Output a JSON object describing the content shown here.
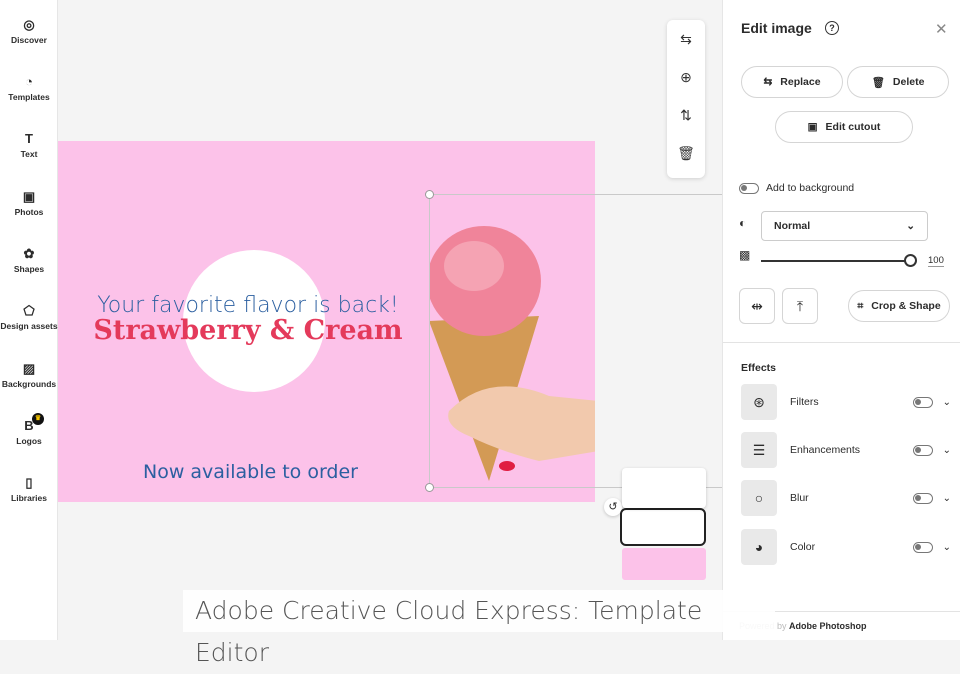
{
  "sidebar": {
    "items": [
      {
        "label": "Discover",
        "icon": "compass-icon",
        "glyph": "◎"
      },
      {
        "label": "Templates",
        "icon": "templates-icon",
        "glyph": "◔"
      },
      {
        "label": "Text",
        "icon": "text-icon",
        "glyph": "T"
      },
      {
        "label": "Photos",
        "icon": "photo-icon",
        "glyph": "▣"
      },
      {
        "label": "Shapes",
        "icon": "shapes-icon",
        "glyph": "✿"
      },
      {
        "label": "Design assets",
        "icon": "design-assets-icon",
        "glyph": "⬠"
      },
      {
        "label": "Backgrounds",
        "icon": "backgrounds-icon",
        "glyph": "▨"
      },
      {
        "label": "Logos",
        "icon": "logos-icon",
        "glyph": "B"
      },
      {
        "label": "Libraries",
        "icon": "libraries-icon",
        "glyph": "▯"
      }
    ]
  },
  "card": {
    "headline": "Your favorite flavor is back!",
    "title": "Strawberry & Cream",
    "subtitle": "Now available to order"
  },
  "panel": {
    "title": "Edit image",
    "replace": "Replace",
    "delete": "Delete",
    "edit_cutout": "Edit cutout",
    "add_to_background": "Add to background",
    "blend_mode": "Normal",
    "opacity": "100",
    "crop_shape": "Crop & Shape",
    "effects_title": "Effects",
    "effects": [
      {
        "label": "Filters"
      },
      {
        "label": "Enhancements"
      },
      {
        "label": "Blur"
      },
      {
        "label": "Color"
      }
    ],
    "powered_by": "Powered by",
    "powered_brand": "Adobe Photoshop"
  },
  "caption": "Adobe Creative Cloud Express: Template Editor",
  "colors": {
    "card_bg": "#fcc2e9",
    "title": "#e43a5b",
    "text": "#2b5fa0"
  }
}
